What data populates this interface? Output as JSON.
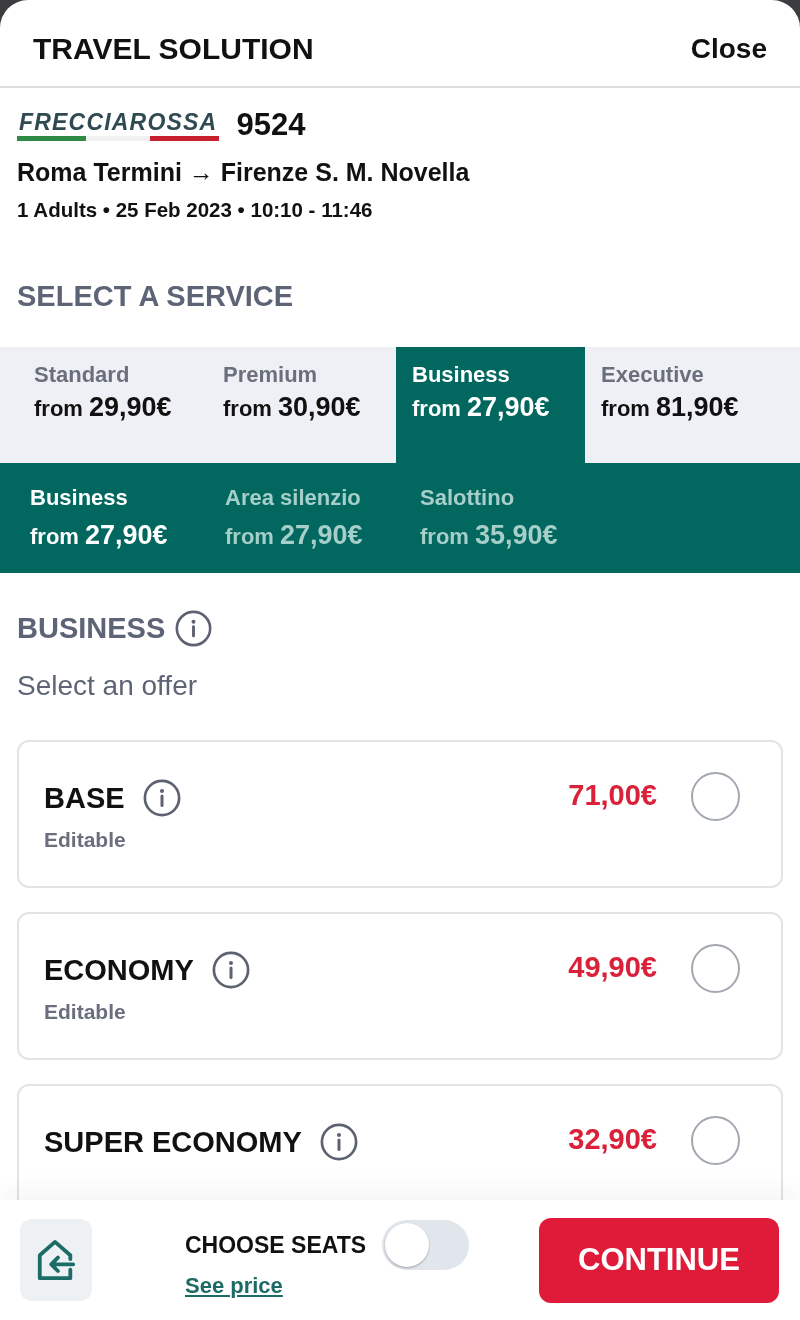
{
  "header": {
    "title": "TRAVEL SOLUTION",
    "close": "Close"
  },
  "train": {
    "brand": "FRECCIAROSSA",
    "number": "9524",
    "route": "Roma Termini → Firenze S. M. Novella",
    "details": "1 Adults • 25 Feb 2023 • 10:10 - 11:46"
  },
  "service_heading": "SELECT A SERVICE",
  "services": [
    {
      "label": "Standard",
      "price": "from **29,90€**",
      "selected": false
    },
    {
      "label": "Premium",
      "price": "from **30,90€**",
      "selected": false
    },
    {
      "label": "Business",
      "price": "from **27,90€**",
      "selected": true
    },
    {
      "label": "Executive",
      "price": "from **81,90€**",
      "selected": false
    }
  ],
  "subservices": [
    {
      "label": "Business",
      "price": "from **27,90€**",
      "selected": true
    },
    {
      "label": "Area silenzio",
      "price": "from **27,90€**",
      "selected": false
    },
    {
      "label": "Salottino",
      "price": "from **35,90€**",
      "selected": false
    }
  ],
  "offer_section": {
    "title": "BUSINESS",
    "subtitle": "Select an offer"
  },
  "offers": [
    {
      "title": "BASE",
      "note": "Editable",
      "price": "71,00€",
      "selected": false
    },
    {
      "title": "ECONOMY",
      "note": "Editable",
      "price": "49,90€",
      "selected": false
    },
    {
      "title": "SUPER ECONOMY",
      "price": "32,90€",
      "selected": false
    }
  ],
  "footer": {
    "seats_label": "CHOOSE SEATS",
    "seats_toggle": {
      "on": false
    },
    "see_price": "See price",
    "continue": "CONTINUE"
  }
}
